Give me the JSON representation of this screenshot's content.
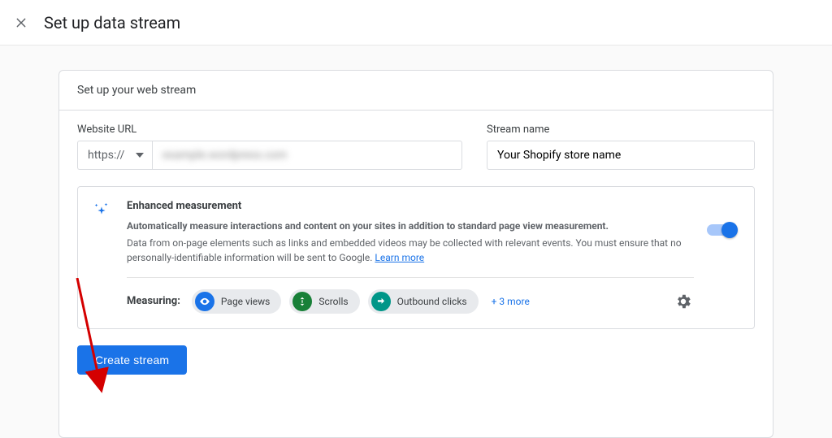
{
  "header": {
    "title": "Set up data stream"
  },
  "card": {
    "title": "Set up your web stream",
    "url_label": "Website URL",
    "protocol": "https://",
    "url_value_blurred": "example.wordpress.com",
    "stream_label": "Stream name",
    "stream_value": "Your Shopify store name"
  },
  "enhanced": {
    "title": "Enhanced measurement",
    "subtitle": "Automatically measure interactions and content on your sites in addition to standard page view measurement.",
    "body": "Data from on-page elements such as links and embedded videos may be collected with relevant events. You must ensure that no personally-identifiable information will be sent to Google. ",
    "learn_more": "Learn more",
    "measuring_label": "Measuring:",
    "chips": [
      {
        "label": "Page views"
      },
      {
        "label": "Scrolls"
      },
      {
        "label": "Outbound clicks"
      }
    ],
    "more": "+ 3 more"
  },
  "actions": {
    "create": "Create stream"
  }
}
